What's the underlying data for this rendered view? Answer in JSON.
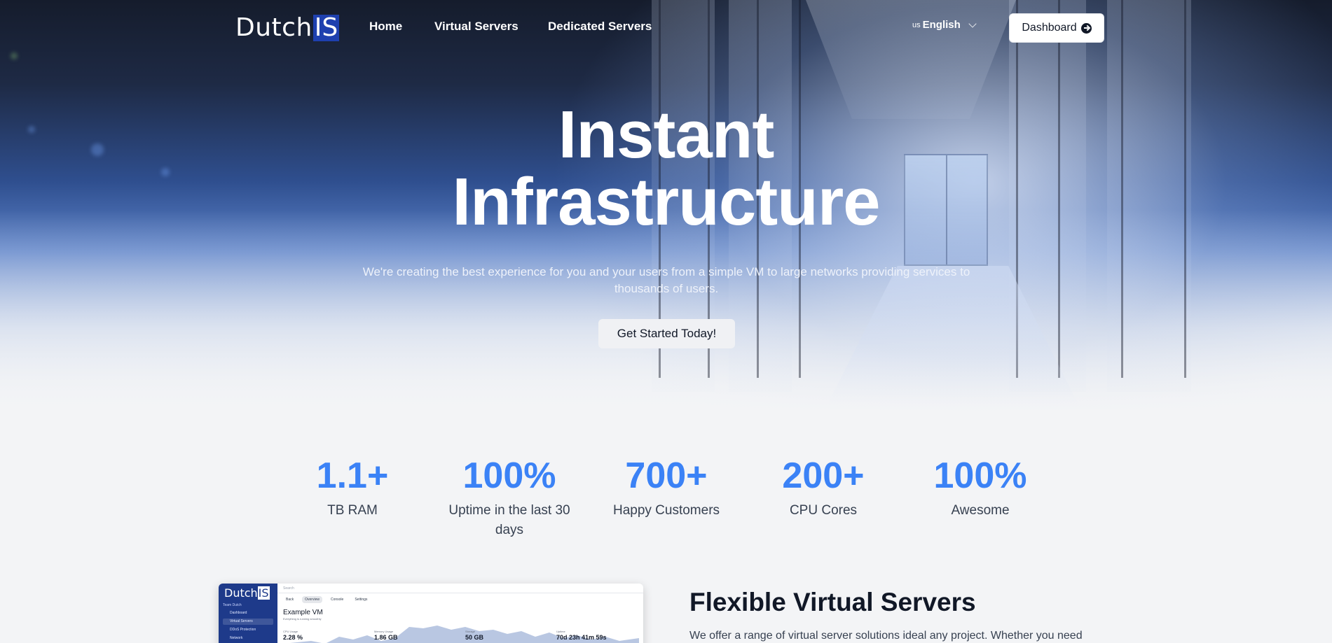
{
  "nav": {
    "logo_text": "Dutch",
    "logo_highlight": "IS",
    "links": [
      "Home",
      "Virtual Servers",
      "Dedicated Servers"
    ],
    "language": {
      "flag": "us",
      "label": "English"
    },
    "dashboard_label": "Dashboard"
  },
  "hero": {
    "title_line1": "Instant",
    "title_line2": "Infrastructure",
    "subtitle": "We're creating the best experience for you and your users from a simple VM to large networks providing services to thousands of users.",
    "cta_label": "Get Started Today!"
  },
  "stats": [
    {
      "value": "1.1+",
      "label": "TB RAM"
    },
    {
      "value": "100%",
      "label": "Uptime in the last 30 days"
    },
    {
      "value": "700+",
      "label": "Happy Customers"
    },
    {
      "value": "200+",
      "label": "CPU Cores"
    },
    {
      "value": "100%",
      "label": "Awesome"
    }
  ],
  "feature": {
    "title": "Flexible Virtual Servers",
    "text": "We offer a range of virtual server solutions ideal any project. Whether you need"
  },
  "preview": {
    "logo_text": "Dutch",
    "logo_highlight": "IS",
    "team": "Team Dutch",
    "sidebar": [
      "Dashboard",
      "Virtual Servers",
      "DDoS Protection",
      "Network"
    ],
    "search": "Search",
    "tabs": [
      "Back",
      "Overview",
      "Console",
      "Settings"
    ],
    "vm_title": "Example VM",
    "vm_subtitle": "Everything is running smoothly",
    "cards": [
      {
        "label": "CPU Usage",
        "value": "2.28 %"
      },
      {
        "label": "Memory Usage",
        "value": "1.86 GB"
      },
      {
        "label": "Storage",
        "value": "50 GB"
      },
      {
        "label": "Uptime",
        "value": "70d 23h 41m 59s"
      }
    ]
  },
  "colors": {
    "accent": "#3b82f6",
    "logo_box": "#1e40af",
    "page_bg": "#f3f4f6"
  }
}
